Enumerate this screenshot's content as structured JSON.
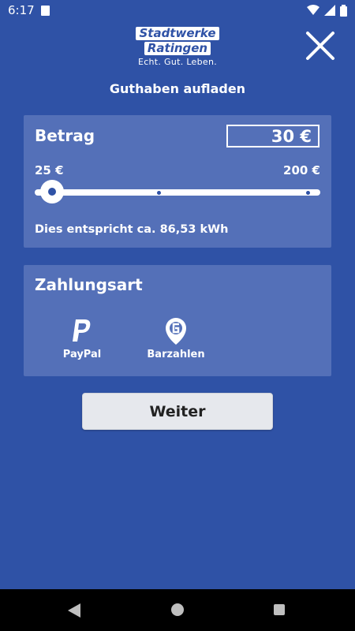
{
  "status_bar": {
    "time": "6:17"
  },
  "logo": {
    "line1": "Stadtwerke",
    "line2": "Ratingen",
    "tagline": "Echt. Gut. Leben."
  },
  "page": {
    "title": "Guthaben aufladen"
  },
  "amount_card": {
    "title": "Betrag",
    "value": "30 €",
    "min_label": "25 €",
    "max_label": "200 €",
    "slider_value": 30,
    "slider_min": 25,
    "slider_max": 200,
    "energy_text": "Dies entspricht ca. 86,53 kWh"
  },
  "payment_card": {
    "title": "Zahlungsart",
    "options": [
      {
        "label": "PayPal",
        "icon": "paypal-icon"
      },
      {
        "label": "Barzahlen",
        "icon": "barzahlen-icon"
      }
    ]
  },
  "actions": {
    "next_label": "Weiter"
  },
  "colors": {
    "background": "#2f52a6",
    "card": "#5470b8",
    "button": "#e6e8ed"
  }
}
